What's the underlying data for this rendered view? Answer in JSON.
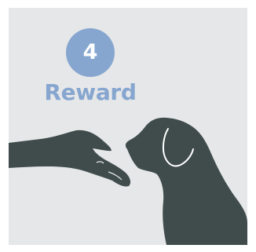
{
  "step": {
    "number": "4",
    "title": "Reward"
  },
  "colors": {
    "background": "#e6e7e8",
    "accent": "#86a6d0",
    "silhouette": "#3f4c4b",
    "outline": "#ffffff"
  },
  "icons": {
    "hand": "hand-icon",
    "dog": "dog-icon"
  }
}
